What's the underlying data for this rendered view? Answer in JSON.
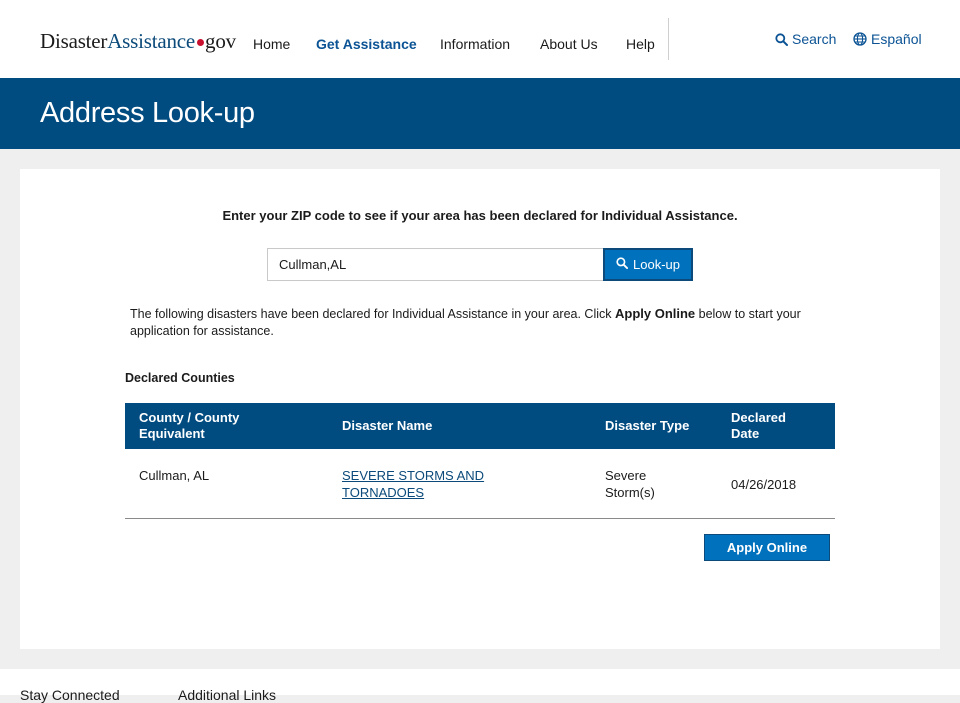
{
  "header": {
    "logo": {
      "part1": "Disaster",
      "part2": "Assistance",
      "part3": "gov"
    },
    "nav": [
      {
        "label": "Home"
      },
      {
        "label": "Get Assistance"
      },
      {
        "label": "Information"
      },
      {
        "label": "About Us"
      },
      {
        "label": "Help"
      }
    ],
    "search_label": "Search",
    "language_label": "Español"
  },
  "banner": {
    "title": "Address Look-up"
  },
  "form": {
    "prompt": "Enter your ZIP code to see if your area has been declared for Individual Assistance.",
    "zip_value": "Cullman,AL",
    "lookup_label": "Look-up"
  },
  "results": {
    "intro_before": "The following disasters have been declared for Individual Assistance in your area. Click ",
    "intro_bold": "Apply Online",
    "intro_after": " below to start your application for assistance.",
    "section_title": "Declared Counties",
    "columns": [
      "County / County Equivalent",
      "Disaster Name",
      "Disaster Type",
      "Declared Date"
    ],
    "rows": [
      {
        "county": "Cullman, AL",
        "disaster_name": "SEVERE STORMS AND TORNADOES",
        "disaster_type": "Severe Storm(s)",
        "declared_date": "04/26/2018"
      }
    ],
    "apply_label": "Apply Online"
  },
  "footer": {
    "stay_connected": "Stay Connected",
    "additional_links": "Additional Links"
  },
  "colors": {
    "brand_blue": "#004b80",
    "button_blue": "#0071bc",
    "link_blue": "#0b4a7a",
    "logo_dot": "#c8102e"
  },
  "icons": [
    "search-icon",
    "globe-icon"
  ]
}
